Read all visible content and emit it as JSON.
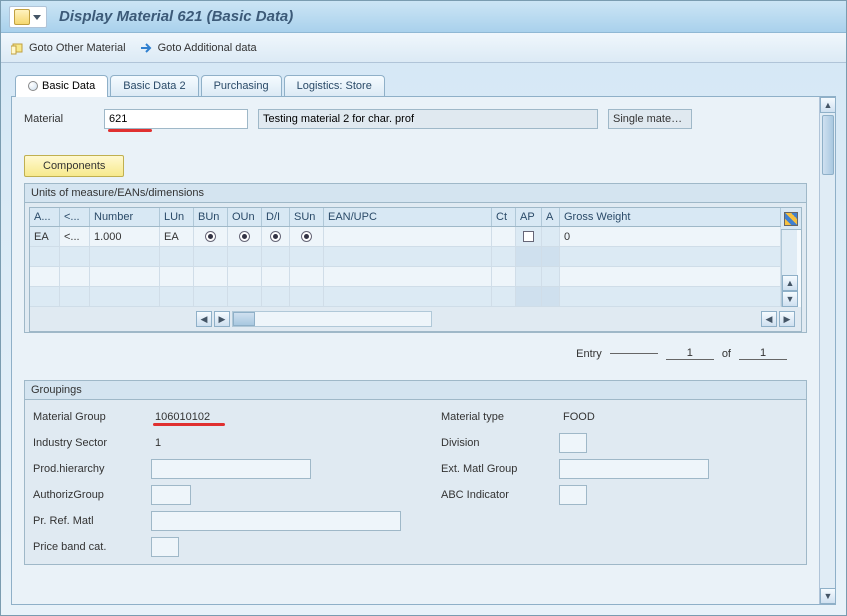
{
  "title": "Display Material 621 (Basic Data)",
  "toolbar": {
    "goto_other": "Goto Other Material",
    "goto_additional": "Goto Additional data"
  },
  "tabs": [
    "Basic Data",
    "Basic Data 2",
    "Purchasing",
    "Logistics: Store"
  ],
  "header": {
    "material_label": "Material",
    "material_value": "621",
    "description": "Testing material 2 for char. prof",
    "single_mate": "Single mate…"
  },
  "components_btn": "Components",
  "uom_title": "Units of measure/EANs/dimensions",
  "grid_headers": [
    "A...",
    "<...",
    "Number",
    "LUn",
    "BUn",
    "OUn",
    "D/I",
    "SUn",
    "EAN/UPC",
    "Ct",
    "AP",
    "A",
    "Gross Weight"
  ],
  "grid_row1": {
    "a": "EA",
    "arrow": "<...",
    "number": "1.000",
    "lun": "EA",
    "gross_weight": "0"
  },
  "entry": {
    "label": "Entry",
    "current": "1",
    "of": "of",
    "total": "1"
  },
  "groupings": {
    "title": "Groupings",
    "left": [
      {
        "label": "Material Group",
        "value": "106010102",
        "underline": true,
        "plain": true
      },
      {
        "label": "Industry Sector",
        "value": "1",
        "plain": true
      },
      {
        "label": "Prod.hierarchy",
        "value": ""
      },
      {
        "label": "AuthorizGroup",
        "value": ""
      },
      {
        "label": "Pr. Ref. Matl",
        "value": ""
      },
      {
        "label": "Price band cat.",
        "value": ""
      }
    ],
    "right": [
      {
        "label": "Material type",
        "value": "FOOD",
        "plain": true
      },
      {
        "label": "Division",
        "value": ""
      },
      {
        "label": "Ext. Matl Group",
        "value": ""
      },
      {
        "label": "ABC Indicator",
        "value": ""
      }
    ]
  }
}
